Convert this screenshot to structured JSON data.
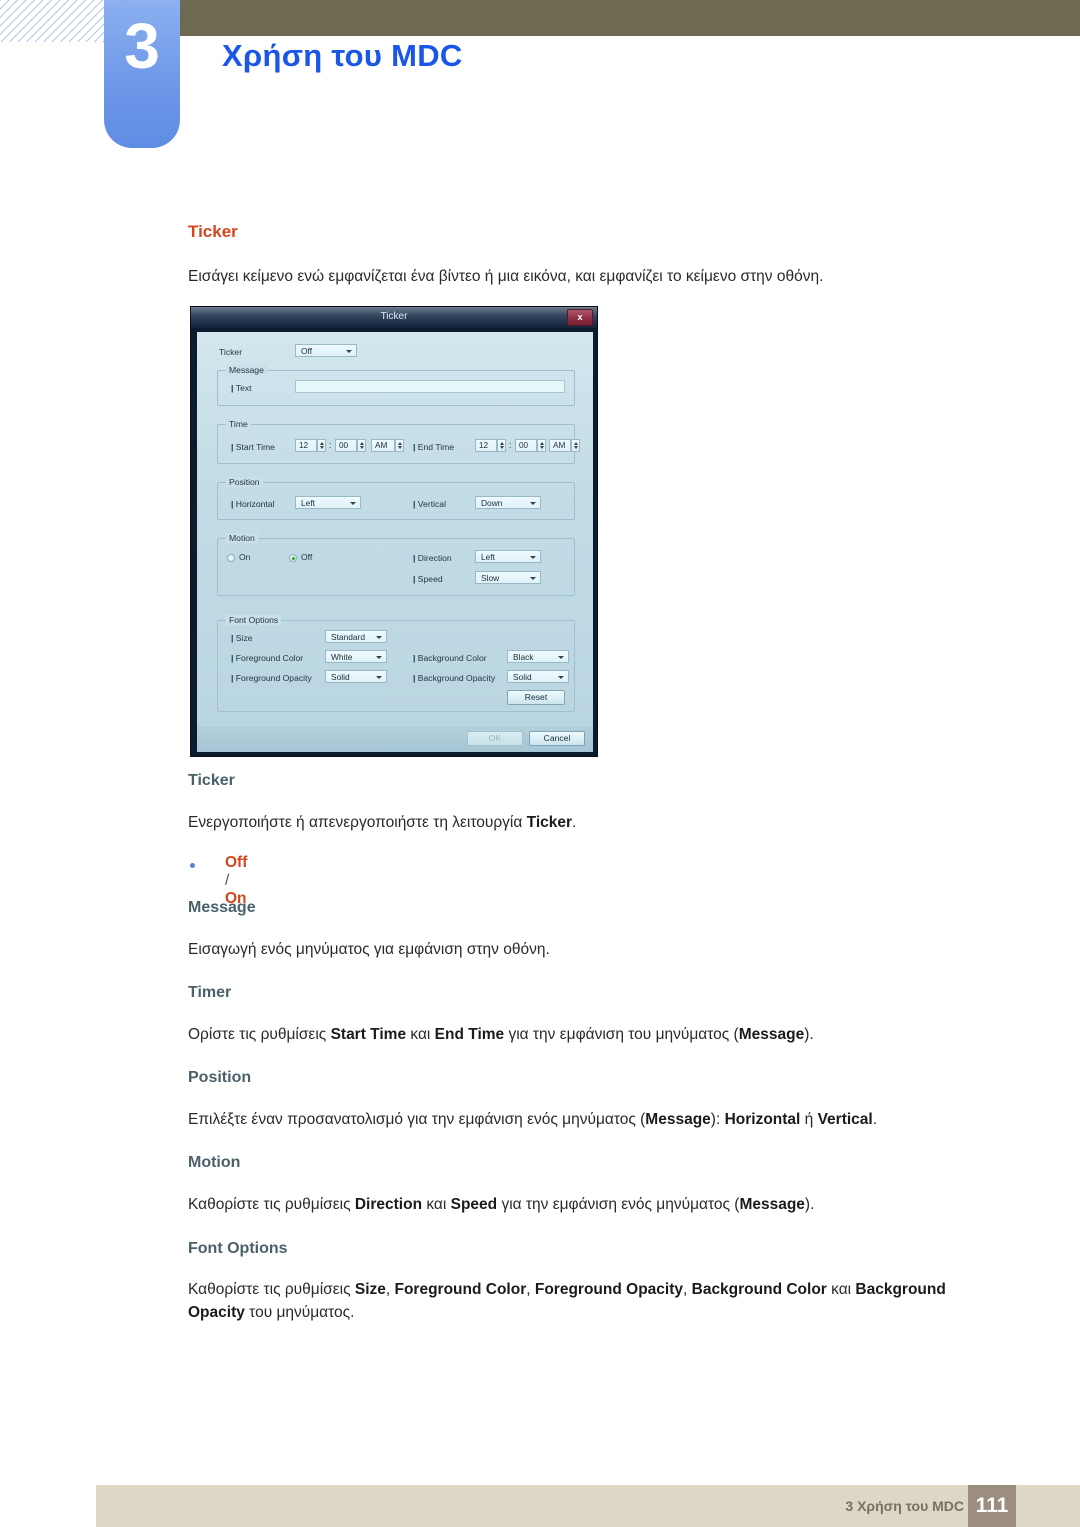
{
  "header": {
    "chapter_number": "3",
    "chapter_title": "Χρήση του MDC"
  },
  "section": {
    "heading": "Ticker",
    "intro": "Εισάγει κείμενο ενώ εμφανίζεται ένα βίντεο ή μια εικόνα, και εμφανίζει το κείμενο στην οθόνη."
  },
  "dialog": {
    "title": "Ticker",
    "close_label": "x",
    "ticker_label": "Ticker",
    "ticker_value": "Off",
    "message_group": "Message",
    "text_label": "Text",
    "text_value": "",
    "time_group": "Time",
    "start_time_label": "Start Time",
    "start_hour": "12",
    "start_minute": "00",
    "start_meridiem": "AM",
    "end_time_label": "End Time",
    "end_hour": "12",
    "end_minute": "00",
    "end_meridiem": "AM",
    "position_group": "Position",
    "horizontal_label": "Horizontal",
    "horizontal_value": "Left",
    "vertical_label": "Vertical",
    "vertical_value": "Down",
    "motion_group": "Motion",
    "motion_on": "On",
    "motion_off": "Off",
    "direction_label": "Direction",
    "direction_value": "Left",
    "speed_label": "Speed",
    "speed_value": "Slow",
    "font_options_group": "Font Options",
    "size_label": "Size",
    "size_value": "Standard",
    "foreground_color_label": "Foreground Color",
    "foreground_color_value": "White",
    "background_color_label": "Background Color",
    "background_color_value": "Black",
    "foreground_opacity_label": "Foreground Opacity",
    "foreground_opacity_value": "Solid",
    "background_opacity_label": "Background Opacity",
    "background_opacity_value": "Solid",
    "reset_label": "Reset",
    "ok_label": "OK",
    "cancel_label": "Cancel"
  },
  "body": {
    "ticker_heading": "Ticker",
    "ticker_text_pre": "Ενεργοποιήστε ή απενεργοποιήστε τη λειτουργία ",
    "ticker_text_bold": "Ticker",
    "ticker_text_post": ".",
    "bullet_off": "Off",
    "bullet_sep": " / ",
    "bullet_on": "On",
    "message_heading": "Message",
    "message_text": "Εισαγωγή ενός μηνύματος για εμφάνιση στην οθόνη.",
    "timer_heading": "Timer",
    "timer_pre": "Ορίστε τις ρυθμίσεις ",
    "timer_b1": "Start Time",
    "timer_mid": " και ",
    "timer_b2": "End Time",
    "timer_mid2": " για την εμφάνιση του μηνύματος (",
    "timer_b3": "Message",
    "timer_post": ").",
    "position_heading": "Position",
    "position_pre": "Επιλέξτε έναν προσανατολισμό για την εμφάνιση ενός μηνύματος (",
    "position_b1": "Message",
    "position_mid": "): ",
    "position_b2": "Horizontal",
    "position_mid2": " ή ",
    "position_b3": "Vertical",
    "position_post": ".",
    "motion_heading": "Motion",
    "motion_pre": "Καθορίστε τις ρυθμίσεις ",
    "motion_b1": "Direction",
    "motion_mid": " και ",
    "motion_b2": "Speed",
    "motion_mid2": " για την εμφάνιση ενός μηνύματος (",
    "motion_b3": "Message",
    "motion_post": ").",
    "font_heading": "Font Options",
    "font_pre": "Καθορίστε τις ρυθμίσεις ",
    "font_b1": "Size",
    "font_s1": ", ",
    "font_b2": "Foreground Color",
    "font_s2": ", ",
    "font_b3": "Foreground Opacity",
    "font_s3": ", ",
    "font_b4": "Background Color",
    "font_s4": " και ",
    "font_b5": "Background Opacity",
    "font_post": " του μηνύματος."
  },
  "footer": {
    "text": "3 Χρήση του MDC",
    "page": "111"
  },
  "colors": {
    "chapter_blue": "#1a56e8",
    "heading_orange": "#d4471c",
    "subheading": "#4a6169",
    "olive_bar": "#6e6a52",
    "footer_bar": "#ddd7c6",
    "page_box": "#9b8e80"
  }
}
